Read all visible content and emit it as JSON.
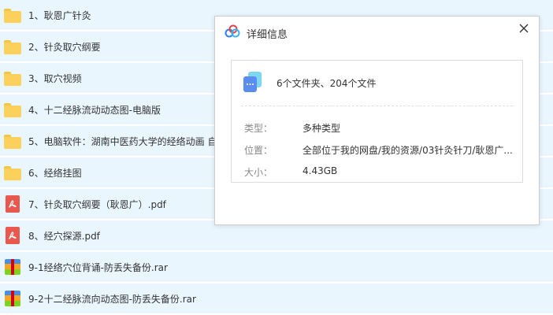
{
  "files": [
    {
      "name": "1、耿恩广针灸",
      "icon": "folder-icon"
    },
    {
      "name": "2、针灸取穴纲要",
      "icon": "folder-icon"
    },
    {
      "name": "3、取穴视频",
      "icon": "folder-icon"
    },
    {
      "name": "4、十二经脉流动动态图-电脑版",
      "icon": "folder-icon"
    },
    {
      "name": "5、电脑软件：湖南中医药大学的经络动画 自",
      "icon": "folder-icon"
    },
    {
      "name": "6、经络挂图",
      "icon": "folder-icon"
    },
    {
      "name": "7、针灸取穴纲要（耿恩广）.pdf",
      "icon": "pdf-file-icon"
    },
    {
      "name": "8、经穴探源.pdf",
      "icon": "pdf-file-icon"
    },
    {
      "name": "9-1经络穴位背诵-防丢失备份.rar",
      "icon": "rar-file-icon"
    },
    {
      "name": "9-2十二经脉流向动态图-防丢失备份.rar",
      "icon": "rar-file-icon"
    }
  ],
  "dialog": {
    "title": "详细信息",
    "summary": "6个文件夹、204个文件",
    "type_label": "类型：",
    "type_value": "多种类型",
    "location_label": "位置：",
    "location_value": "全部位于我的网盘/我的资源/03针灸针刀/耿恩广...",
    "size_label": "大小：",
    "size_value": "4.43GB"
  },
  "colors": {
    "list_background": "#eaf6fd",
    "folder": "#fcd15b",
    "pdf": "#e9584f",
    "dialog_border": "#c9ccd1"
  }
}
